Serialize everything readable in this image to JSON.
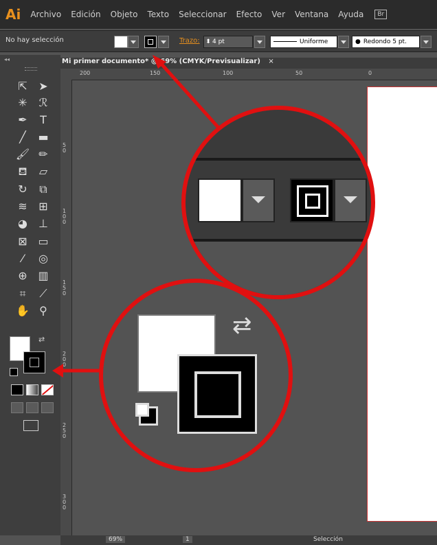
{
  "app": {
    "logo": "Ai"
  },
  "menu": [
    "Archivo",
    "Edición",
    "Objeto",
    "Texto",
    "Seleccionar",
    "Efecto",
    "Ver",
    "Ventana",
    "Ayuda"
  ],
  "bridge_label": "Br",
  "control": {
    "selection_status": "No hay selección",
    "stroke_label": "Trazo:",
    "stroke_weight": "4 pt",
    "profile": "Uniforme",
    "brush": "Redondo 5 pt."
  },
  "document": {
    "tab_title": "Mi primer documento* @ 69% (CMYK/Previsualizar)",
    "close": "×"
  },
  "ruler_top_ticks": [
    "200",
    "150",
    "100",
    "50",
    "0"
  ],
  "ruler_left_ticks": [
    "5\n0",
    "1\n0\n0",
    "1\n5\n0",
    "2\n0\n0",
    "2\n5\n0",
    "3\n0\n0"
  ],
  "status": {
    "zoom": "69%",
    "page": "1",
    "mode": "Selección"
  },
  "colors": {
    "accent": "#e01010",
    "ai_orange": "#e8901e",
    "fill": "#ffffff",
    "stroke": "#000000"
  }
}
